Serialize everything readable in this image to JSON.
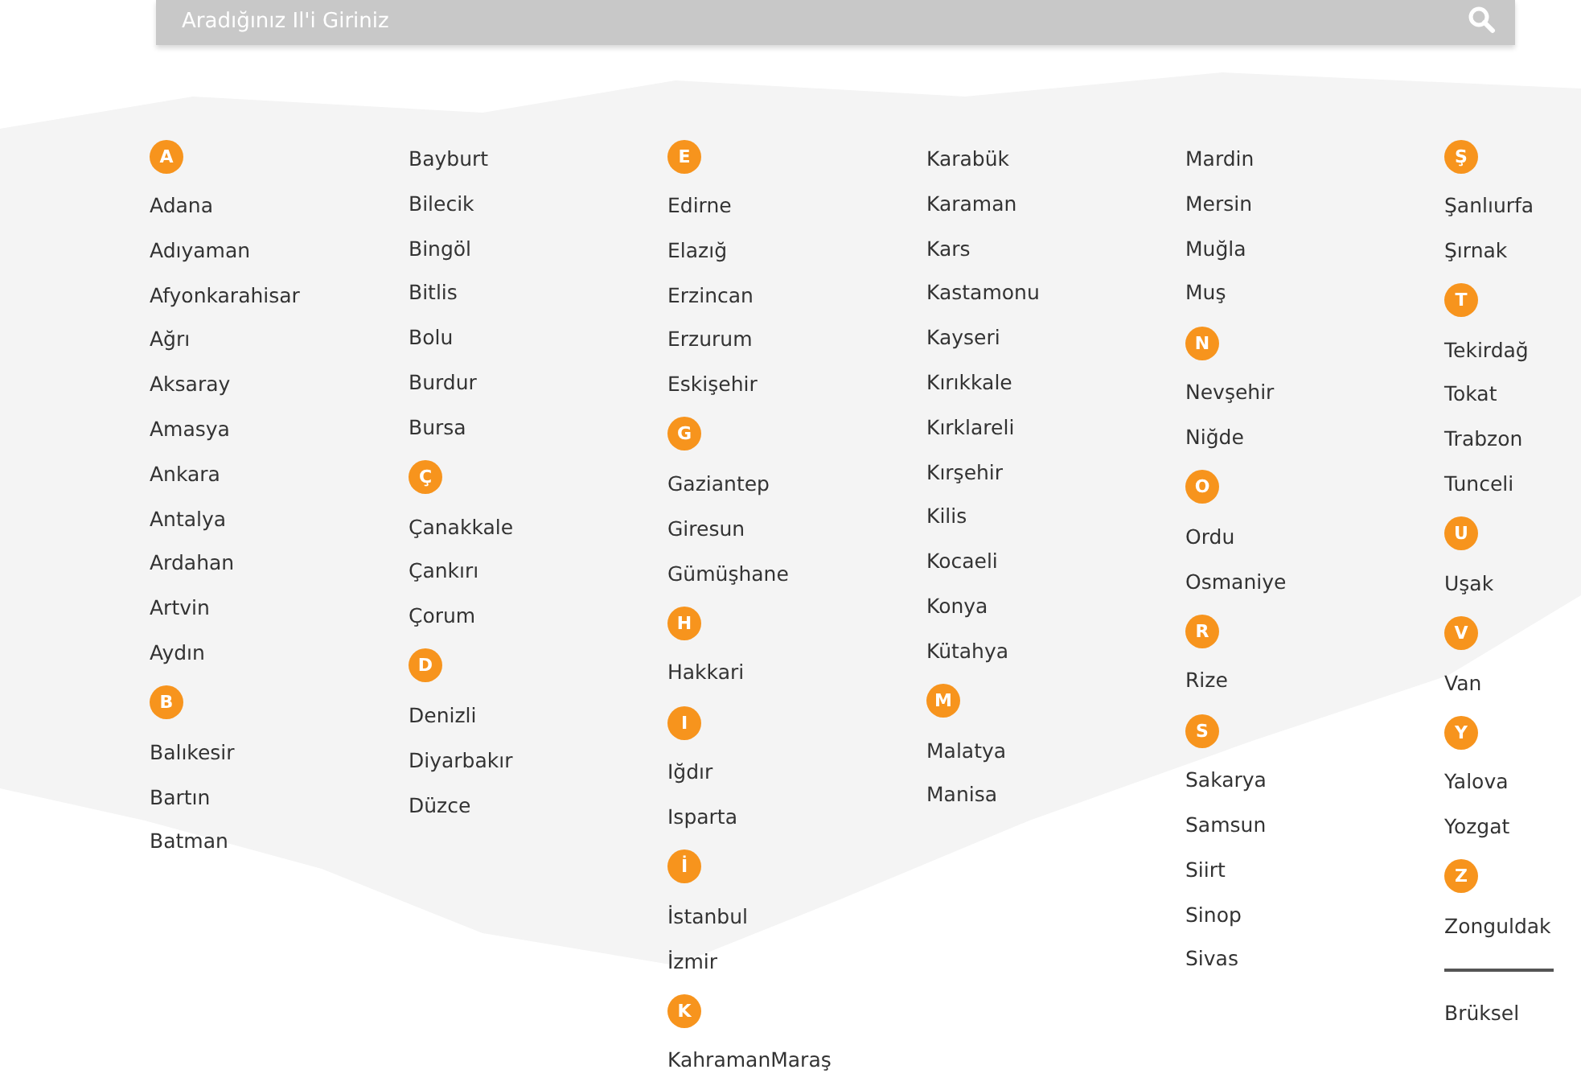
{
  "search": {
    "placeholder": "Aradığınız Il'i Giriniz"
  },
  "columns": [
    {
      "items": [
        {
          "kind": "letter",
          "text": "A"
        },
        {
          "kind": "city",
          "text": "Adana"
        },
        {
          "kind": "city",
          "text": "Adıyaman"
        },
        {
          "kind": "city",
          "text": "Afyonkarahisar"
        },
        {
          "kind": "city",
          "text": "Ağrı"
        },
        {
          "kind": "city",
          "text": "Aksaray"
        },
        {
          "kind": "city",
          "text": "Amasya"
        },
        {
          "kind": "city",
          "text": "Ankara"
        },
        {
          "kind": "city",
          "text": "Antalya"
        },
        {
          "kind": "city",
          "text": "Ardahan"
        },
        {
          "kind": "city",
          "text": "Artvin"
        },
        {
          "kind": "city",
          "text": "Aydın"
        },
        {
          "kind": "letter",
          "text": "B"
        },
        {
          "kind": "city",
          "text": "Balıkesir"
        },
        {
          "kind": "city",
          "text": "Bartın"
        },
        {
          "kind": "city",
          "text": "Batman"
        }
      ]
    },
    {
      "items": [
        {
          "kind": "city",
          "text": "Bayburt"
        },
        {
          "kind": "city",
          "text": "Bilecik"
        },
        {
          "kind": "city",
          "text": "Bingöl"
        },
        {
          "kind": "city",
          "text": "Bitlis"
        },
        {
          "kind": "city",
          "text": "Bolu"
        },
        {
          "kind": "city",
          "text": "Burdur"
        },
        {
          "kind": "city",
          "text": "Bursa"
        },
        {
          "kind": "letter",
          "text": "Ç"
        },
        {
          "kind": "city",
          "text": "Çanakkale"
        },
        {
          "kind": "city",
          "text": "Çankırı"
        },
        {
          "kind": "city",
          "text": "Çorum"
        },
        {
          "kind": "letter",
          "text": "D"
        },
        {
          "kind": "city",
          "text": "Denizli"
        },
        {
          "kind": "city",
          "text": "Diyarbakır"
        },
        {
          "kind": "city",
          "text": "Düzce"
        }
      ]
    },
    {
      "items": [
        {
          "kind": "letter",
          "text": "E"
        },
        {
          "kind": "city",
          "text": "Edirne"
        },
        {
          "kind": "city",
          "text": "Elazığ"
        },
        {
          "kind": "city",
          "text": "Erzincan"
        },
        {
          "kind": "city",
          "text": "Erzurum"
        },
        {
          "kind": "city",
          "text": "Eskişehir"
        },
        {
          "kind": "letter",
          "text": "G"
        },
        {
          "kind": "city",
          "text": "Gaziantep"
        },
        {
          "kind": "city",
          "text": "Giresun"
        },
        {
          "kind": "city",
          "text": "Gümüşhane"
        },
        {
          "kind": "letter",
          "text": "H"
        },
        {
          "kind": "city",
          "text": "Hakkari"
        },
        {
          "kind": "letter",
          "text": "I"
        },
        {
          "kind": "city",
          "text": "Iğdır"
        },
        {
          "kind": "city",
          "text": "Isparta"
        },
        {
          "kind": "letter",
          "text": "İ"
        },
        {
          "kind": "city",
          "text": "İstanbul"
        },
        {
          "kind": "city",
          "text": "İzmir"
        },
        {
          "kind": "letter",
          "text": "K"
        },
        {
          "kind": "city",
          "text": "KahramanMaraş"
        }
      ]
    },
    {
      "items": [
        {
          "kind": "city",
          "text": "Karabük"
        },
        {
          "kind": "city",
          "text": "Karaman"
        },
        {
          "kind": "city",
          "text": "Kars"
        },
        {
          "kind": "city",
          "text": "Kastamonu"
        },
        {
          "kind": "city",
          "text": "Kayseri"
        },
        {
          "kind": "city",
          "text": "Kırıkkale"
        },
        {
          "kind": "city",
          "text": "Kırklareli"
        },
        {
          "kind": "city",
          "text": "Kırşehir"
        },
        {
          "kind": "city",
          "text": "Kilis"
        },
        {
          "kind": "city",
          "text": "Kocaeli"
        },
        {
          "kind": "city",
          "text": "Konya"
        },
        {
          "kind": "city",
          "text": "Kütahya"
        },
        {
          "kind": "letter",
          "text": "M"
        },
        {
          "kind": "city",
          "text": "Malatya"
        },
        {
          "kind": "city",
          "text": "Manisa"
        }
      ]
    },
    {
      "items": [
        {
          "kind": "city",
          "text": "Mardin"
        },
        {
          "kind": "city",
          "text": "Mersin"
        },
        {
          "kind": "city",
          "text": "Muğla"
        },
        {
          "kind": "city",
          "text": "Muş"
        },
        {
          "kind": "letter",
          "text": "N"
        },
        {
          "kind": "city",
          "text": "Nevşehir"
        },
        {
          "kind": "city",
          "text": "Niğde"
        },
        {
          "kind": "letter",
          "text": "O"
        },
        {
          "kind": "city",
          "text": "Ordu"
        },
        {
          "kind": "city",
          "text": "Osmaniye"
        },
        {
          "kind": "letter",
          "text": "R"
        },
        {
          "kind": "city",
          "text": "Rize"
        },
        {
          "kind": "letter",
          "text": "S"
        },
        {
          "kind": "city",
          "text": "Sakarya"
        },
        {
          "kind": "city",
          "text": "Samsun"
        },
        {
          "kind": "city",
          "text": "Siirt"
        },
        {
          "kind": "city",
          "text": "Sinop"
        },
        {
          "kind": "city",
          "text": "Sivas"
        }
      ]
    },
    {
      "items": [
        {
          "kind": "letter",
          "text": "Ş"
        },
        {
          "kind": "city",
          "text": "Şanlıurfa"
        },
        {
          "kind": "city",
          "text": "Şırnak"
        },
        {
          "kind": "letter",
          "text": "T"
        },
        {
          "kind": "city",
          "text": "Tekirdağ"
        },
        {
          "kind": "city",
          "text": "Tokat"
        },
        {
          "kind": "city",
          "text": "Trabzon"
        },
        {
          "kind": "city",
          "text": "Tunceli"
        },
        {
          "kind": "letter",
          "text": "U"
        },
        {
          "kind": "city",
          "text": "Uşak"
        },
        {
          "kind": "letter",
          "text": "V"
        },
        {
          "kind": "city",
          "text": "Van"
        },
        {
          "kind": "letter",
          "text": "Y"
        },
        {
          "kind": "city",
          "text": "Yalova"
        },
        {
          "kind": "city",
          "text": "Yozgat"
        },
        {
          "kind": "letter",
          "text": "Z"
        },
        {
          "kind": "city",
          "text": "Zonguldak"
        },
        {
          "kind": "separator"
        },
        {
          "kind": "city",
          "text": "Brüksel"
        }
      ]
    }
  ]
}
